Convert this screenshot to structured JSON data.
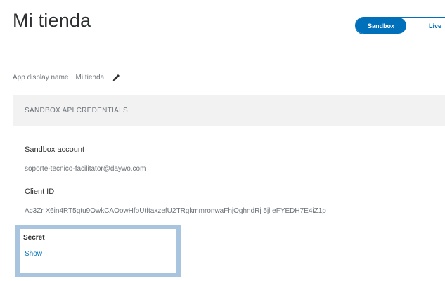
{
  "page": {
    "title": "Mi tienda"
  },
  "env_toggle": {
    "sandbox_label": "Sandbox",
    "live_label": "Live",
    "selected": "Sandbox",
    "accent_color": "#0070ba"
  },
  "app_display_name": {
    "label": "App display name",
    "value": "Mi tienda",
    "edit_icon": "pencil-icon"
  },
  "credentials": {
    "section_title": "SANDBOX API CREDENTIALS",
    "sandbox_account_label": "Sandbox account",
    "sandbox_account_value": "soporte-tecnico-facilitator@daywo.com",
    "client_id_label": "Client ID",
    "client_id_value": "Ac3Zr X6in4RT5gtu9OwkCAOowHfoUtftaxzefU2TRgkmmronwaFhjOghndRj 5jl eFYEDH7E4iZ1p",
    "secret_label": "Secret",
    "secret_action": "Show",
    "highlight_color": "#a9c4df"
  }
}
